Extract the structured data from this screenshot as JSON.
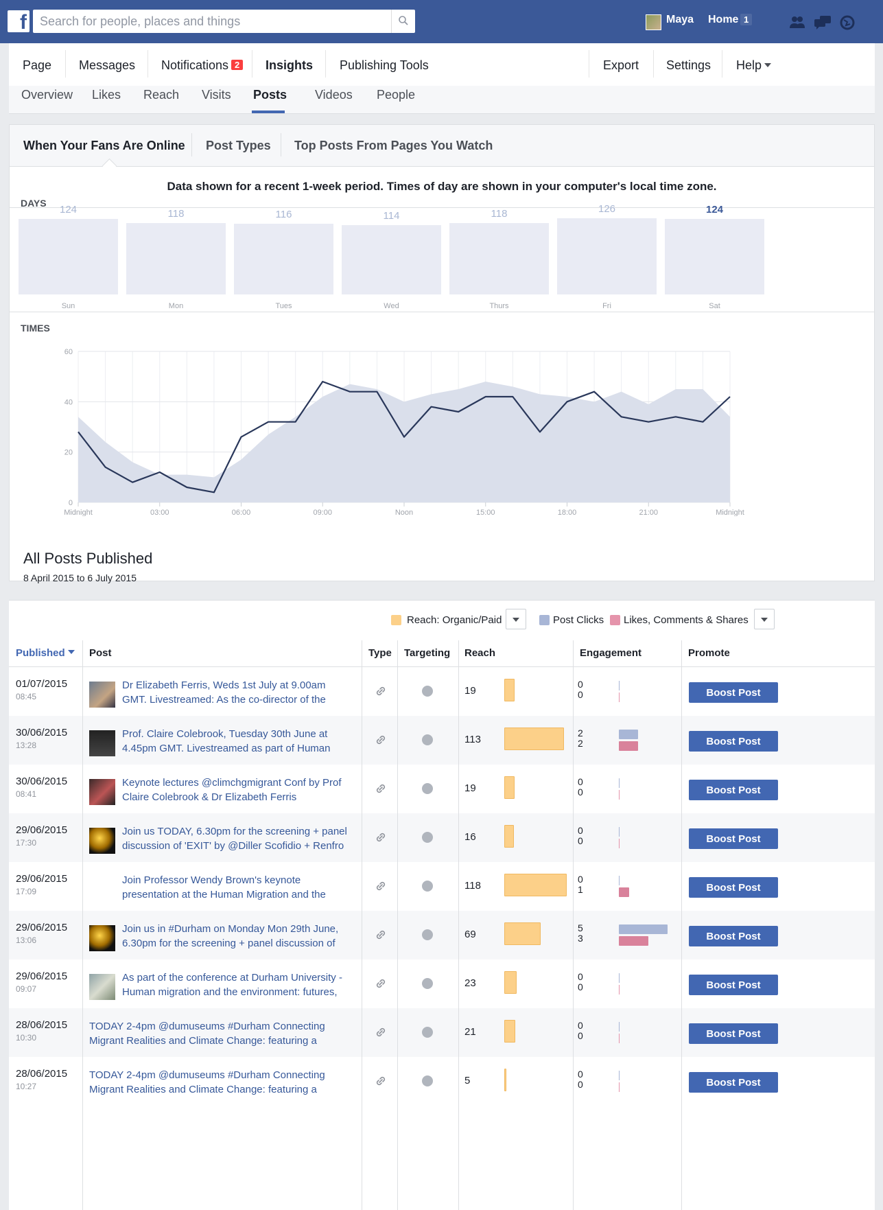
{
  "topbar": {
    "search_placeholder": "Search for people, places and things",
    "user_name": "Maya",
    "home_label": "Home",
    "home_count": "1"
  },
  "page_nav": {
    "items": [
      "Page",
      "Messages",
      "Notifications",
      "Insights",
      "Publishing Tools"
    ],
    "notifications_count": "2",
    "right_items": [
      "Export",
      "Settings",
      "Help"
    ]
  },
  "sub_tabs": [
    "Overview",
    "Likes",
    "Reach",
    "Visits",
    "Posts",
    "Videos",
    "People"
  ],
  "inner_tabs": [
    "When Your Fans Are Online",
    "Post Types",
    "Top Posts From Pages You Watch"
  ],
  "info_text": "Data shown for a recent 1-week period. Times of day are shown in your computer's local time zone.",
  "days_label": "DAYS",
  "times_label": "TIMES",
  "chart_data": [
    {
      "type": "bar",
      "title": "DAYS",
      "categories": [
        "Sun",
        "Mon",
        "Tues",
        "Wed",
        "Thurs",
        "Fri",
        "Sat"
      ],
      "values": [
        124,
        118,
        116,
        114,
        118,
        126,
        124
      ],
      "highlighted": "Sat"
    },
    {
      "type": "line",
      "title": "TIMES",
      "ylim": [
        0,
        60
      ],
      "yticks": [
        0,
        20,
        40,
        60
      ],
      "xtick_labels": [
        "Midnight",
        "03:00",
        "06:00",
        "09:00",
        "Noon",
        "15:00",
        "18:00",
        "21:00",
        "Midnight"
      ],
      "x": [
        0,
        1,
        2,
        3,
        4,
        5,
        6,
        7,
        8,
        9,
        10,
        11,
        12,
        13,
        14,
        15,
        16,
        17,
        18,
        19,
        20,
        21,
        22,
        23,
        24
      ],
      "series": [
        {
          "style": "area",
          "values": [
            34,
            24,
            16,
            11,
            11,
            10,
            17,
            27,
            34,
            42,
            47,
            45,
            40,
            43,
            45,
            48,
            46,
            43,
            42,
            40,
            44,
            39,
            45,
            45,
            34
          ]
        },
        {
          "style": "line",
          "values": [
            28,
            14,
            8,
            12,
            6,
            4,
            26,
            32,
            32,
            48,
            44,
            44,
            26,
            38,
            36,
            42,
            42,
            28,
            40,
            44,
            34,
            32,
            34,
            32,
            42
          ]
        }
      ]
    }
  ],
  "all_posts": {
    "title": "All Posts Published",
    "date_range": "8 April 2015 to 6 July 2015",
    "legend": [
      "Reach: Organic/Paid",
      "Post Clicks",
      "Likes, Comments & Shares"
    ],
    "legend_colors": [
      "#fcd089",
      "#a8b6d6",
      "#e594ab"
    ],
    "columns": [
      "Published",
      "Post",
      "Type",
      "Targeting",
      "Reach",
      "Engagement",
      "Promote"
    ],
    "boost_label": "Boost Post",
    "rows": [
      {
        "date": "01/07/2015",
        "time": "08:45",
        "text": "Dr Elizabeth Ferris, Weds 1st July at 9.00am GMT. Livestreamed: As the co-director of the",
        "thumb": "video",
        "reach": 19,
        "clicks": 0,
        "likes": 0
      },
      {
        "date": "30/06/2015",
        "time": "13:28",
        "text": "Prof. Claire Colebrook, Tuesday 30th June at 4.45pm GMT. Livestreamed as part of Human",
        "thumb": "video-dark",
        "reach": 113,
        "clicks": 2,
        "likes": 2
      },
      {
        "date": "30/06/2015",
        "time": "08:41",
        "text": "Keynote lectures @climchgmigrant Conf by Prof Claire Colebrook & Dr Elizabeth Ferris",
        "thumb": "video-red",
        "reach": 19,
        "clicks": 0,
        "likes": 0
      },
      {
        "date": "29/06/2015",
        "time": "17:30",
        "text": "Join us TODAY, 6.30pm for the screening + panel discussion of 'EXIT' by @Diller Scofidio + Renfro",
        "thumb": "gold",
        "reach": 16,
        "clicks": 0,
        "likes": 0
      },
      {
        "date": "29/06/2015",
        "time": "17:09",
        "text": "Join Professor Wendy Brown's keynote presentation at the Human Migration and the",
        "thumb": "none-indent",
        "reach": 118,
        "clicks": 0,
        "likes": 1
      },
      {
        "date": "29/06/2015",
        "time": "13:06",
        "text": "Join us in #Durham on Monday Mon 29th June, 6.30pm for the screening + panel discussion of",
        "thumb": "gold",
        "reach": 69,
        "clicks": 5,
        "likes": 3
      },
      {
        "date": "29/06/2015",
        "time": "09:07",
        "text": "As part of the conference at Durham University - Human migration and the environment: futures,",
        "thumb": "photo",
        "reach": 23,
        "clicks": 0,
        "likes": 0
      },
      {
        "date": "28/06/2015",
        "time": "10:30",
        "text": "TODAY 2-4pm @dumuseums #Durham Connecting Migrant Realities and Climate Change: featuring a",
        "thumb": "none",
        "reach": 21,
        "clicks": 0,
        "likes": 0
      },
      {
        "date": "28/06/2015",
        "time": "10:27",
        "text": "TODAY 2-4pm @dumuseums #Durham Connecting Migrant Realities and Climate Change: featuring a",
        "thumb": "none",
        "reach": 5,
        "clicks": 0,
        "likes": 0
      }
    ]
  }
}
